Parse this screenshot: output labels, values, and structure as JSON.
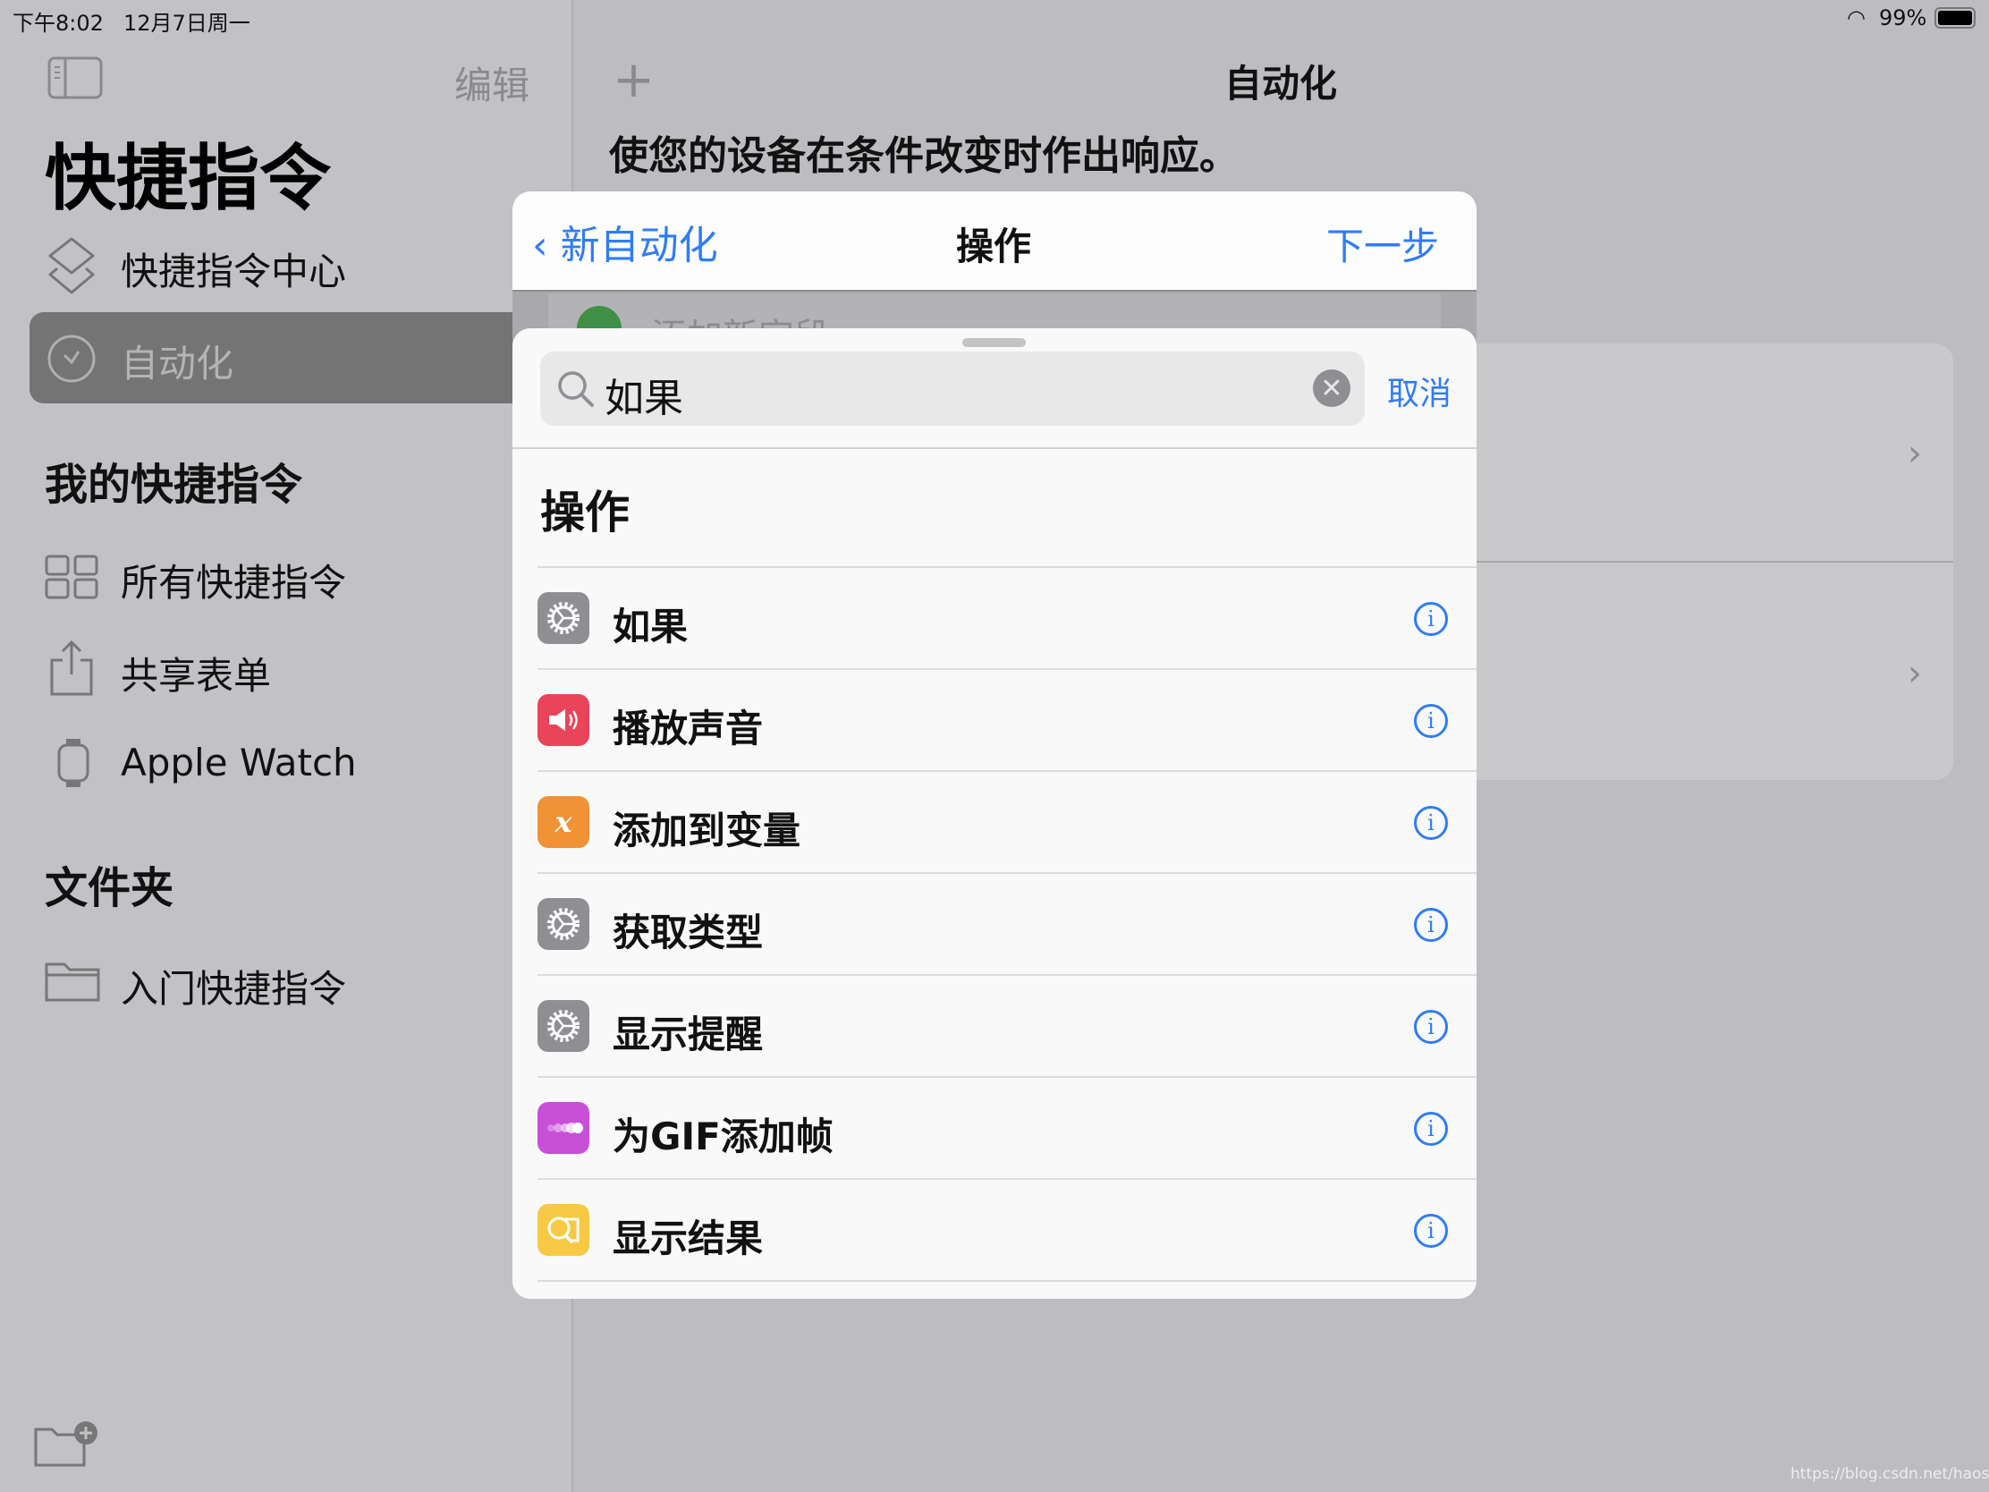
{
  "status_bar": {
    "time": "下午8:02",
    "date": "12月7日周一",
    "battery": "99%"
  },
  "sidebar": {
    "edit": "编辑",
    "title": "快捷指令",
    "items": [
      {
        "label": "快捷指令中心",
        "icon": "layers-icon"
      },
      {
        "label": "自动化",
        "icon": "clock-icon",
        "selected": true
      }
    ],
    "my_shortcuts_header": "我的快捷指令",
    "my_items": [
      {
        "label": "所有快捷指令",
        "icon": "grid-icon"
      },
      {
        "label": "共享表单",
        "icon": "share-icon"
      },
      {
        "label": "Apple Watch",
        "icon": "watch-icon"
      }
    ],
    "folders_header": "文件夹",
    "folders": [
      {
        "label": "入门快捷指令",
        "icon": "folder-icon"
      }
    ]
  },
  "main": {
    "title": "自动化",
    "subtitle": "使您的设备在条件改变时作出响应。"
  },
  "back_sheet": {
    "back_label": "新自动化",
    "title": "操作",
    "next_label": "下一步",
    "faded_row": "添加新字段"
  },
  "search": {
    "value": "如果",
    "cancel": "取消"
  },
  "section_title": "操作",
  "actions": [
    {
      "label": "如果",
      "icon": "gear-icon",
      "color": "#8e8e93"
    },
    {
      "label": "播放声音",
      "icon": "speaker-icon",
      "color": "#ea445a"
    },
    {
      "label": "添加到变量",
      "icon": "variable-icon",
      "color": "#f09235"
    },
    {
      "label": "获取类型",
      "icon": "gear-icon",
      "color": "#8e8e93"
    },
    {
      "label": "显示提醒",
      "icon": "gear-icon",
      "color": "#8e8e93"
    },
    {
      "label": "为GIF添加帧",
      "icon": "gif-frames-icon",
      "color": "#c84fd8"
    },
    {
      "label": "显示结果",
      "icon": "quicklook-icon",
      "color": "#f7c944"
    }
  ],
  "accent": "#2f7cf6",
  "watermark": "https://blog.csdn.net/haostart"
}
